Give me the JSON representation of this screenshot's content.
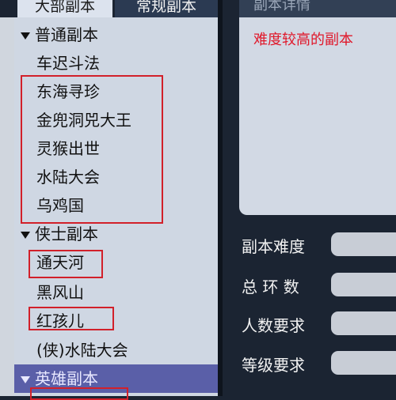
{
  "tabs": {
    "all": "大部副本",
    "normal": "常规副本"
  },
  "tree": {
    "category_normal": "普通副本",
    "normal_items": [
      "车迟斗法",
      "东海寻珍",
      "金兜洞兕大王",
      "灵猴出世",
      "水陆大会",
      "乌鸡国"
    ],
    "category_hero": "侠士副本",
    "hero_items": [
      "通天河",
      "黑风山",
      "红孩儿",
      "(侠)水陆大会"
    ],
    "category_legend": "英雄副本"
  },
  "detail": {
    "header": "副本详情",
    "description": "难度较高的副本"
  },
  "stats": {
    "difficulty_label": "副本难度",
    "rounds_label": "总 环 数",
    "players_label": "人数要求",
    "level_label": "等级要求"
  },
  "colors": {
    "highlight_box": "#d2202a",
    "selected_row": "#5a5fa8",
    "description_text": "#e0182a"
  }
}
